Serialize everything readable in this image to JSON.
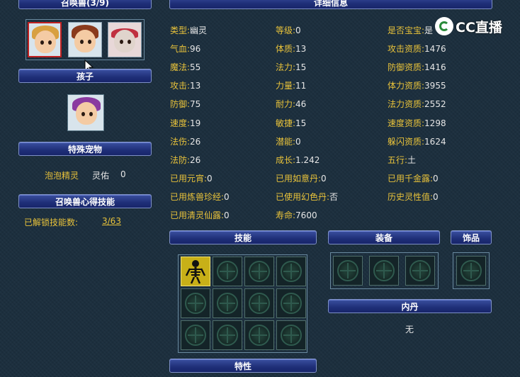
{
  "left": {
    "summon_header": "召唤兽(3/9)",
    "child_header": "孩子",
    "special_pet_header": "特殊宠物",
    "special_pet_name": "泡泡精灵",
    "special_pet_stat_label": "灵佑",
    "special_pet_stat_value": "0",
    "skill_header": "召唤兽心得技能",
    "unlocked_label": "已解锁技能数:",
    "unlocked_value": "3/63"
  },
  "detail": {
    "header": "详细信息",
    "rows": [
      [
        {
          "label": "类型:",
          "value": "幽灵"
        },
        {
          "label": "等级:",
          "value": "0"
        },
        {
          "label": "是否宝宝:",
          "value": "是"
        }
      ],
      [
        {
          "label": "气血:",
          "value": "96"
        },
        {
          "label": "体质:",
          "value": "13"
        },
        {
          "label": "攻击资质:",
          "value": "1476"
        }
      ],
      [
        {
          "label": "魔法:",
          "value": "55"
        },
        {
          "label": "法力:",
          "value": "15"
        },
        {
          "label": "防御资质:",
          "value": "1416"
        }
      ],
      [
        {
          "label": "攻击:",
          "value": "13"
        },
        {
          "label": "力量:",
          "value": "11"
        },
        {
          "label": "体力资质:",
          "value": "3955"
        }
      ],
      [
        {
          "label": "防御:",
          "value": "75"
        },
        {
          "label": "耐力:",
          "value": "46"
        },
        {
          "label": "法力资质:",
          "value": "2552"
        }
      ],
      [
        {
          "label": "速度:",
          "value": "19"
        },
        {
          "label": "敏捷:",
          "value": "15"
        },
        {
          "label": "速度资质:",
          "value": "1298"
        }
      ],
      [
        {
          "label": "法伤:",
          "value": "26"
        },
        {
          "label": "潜能:",
          "value": "0"
        },
        {
          "label": "躲闪资质:",
          "value": "1624"
        }
      ],
      [
        {
          "label": "法防:",
          "value": "26"
        },
        {
          "label": "成长:",
          "value": "1.242"
        },
        {
          "label": "五行:",
          "value": "土"
        }
      ],
      [
        {
          "label": "已用元宵:",
          "value": "0"
        },
        {
          "label": "已用如意丹:",
          "value": "0"
        },
        {
          "label": "已用千金露:",
          "value": "0"
        }
      ],
      [
        {
          "label": "已用炼兽珍经:",
          "value": "0"
        },
        {
          "label": "已使用幻色丹:",
          "value": "否"
        },
        {
          "label": "历史灵性值:",
          "value": "0"
        }
      ],
      [
        {
          "label": "已用清灵仙露:",
          "value": "0"
        },
        {
          "label": "寿命:",
          "value": "7600"
        }
      ]
    ]
  },
  "sections": {
    "skills": "技能",
    "equipment": "装备",
    "accessory": "饰品",
    "inner_dan": "内丹",
    "inner_dan_value": "无",
    "traits": "特性"
  },
  "watermark": "CC直播",
  "colors": {
    "label": "#e8c23a",
    "value": "#e6e6e6",
    "header_bg": "#1f2f78",
    "background": "#1c2f3e"
  }
}
